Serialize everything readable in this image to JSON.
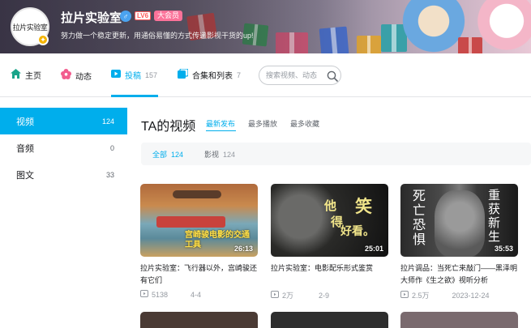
{
  "header": {
    "avatar_text": "拉片实验室",
    "username": "拉片实验室",
    "level": "LV6",
    "vip": "大会员",
    "signature": "努力做一个稳定更新，用通俗易懂的方式传递影视干货的up!",
    "colors": {
      "accent": "#00aeec",
      "vip": "#fb7299",
      "level": "#ff5a5a"
    }
  },
  "nav": {
    "tabs": [
      {
        "label": "主页",
        "icon": "home-icon",
        "count": ""
      },
      {
        "label": "动态",
        "icon": "flower-icon",
        "count": ""
      },
      {
        "label": "投稿",
        "icon": "upload-icon",
        "count": "157",
        "active": true
      },
      {
        "label": "合集和列表",
        "icon": "collection-icon",
        "count": "7"
      }
    ],
    "search_placeholder": "搜索视频、动态"
  },
  "sidebar": {
    "items": [
      {
        "label": "视频",
        "count": "124",
        "active": true
      },
      {
        "label": "音频",
        "count": "0"
      },
      {
        "label": "图文",
        "count": "33"
      }
    ]
  },
  "main": {
    "title": "TA的视频",
    "sort_tabs": [
      "最新发布",
      "最多播放",
      "最多收藏"
    ],
    "filters": [
      {
        "label": "全部",
        "count": "124",
        "active": true
      },
      {
        "label": "影视",
        "count": "124"
      }
    ],
    "videos": [
      {
        "title": "拉片实验室：飞行器以外，宫崎骏还有它们",
        "duration": "26:13",
        "plays": "5138",
        "date": "4-4",
        "thumb_text": "宫崎骏电影的交通工具"
      },
      {
        "title": "拉片实验室：电影配乐形式鉴赏",
        "duration": "25:01",
        "plays": "2万",
        "date": "2-9",
        "thumb_text": [
          "他",
          "得",
          "笑",
          "好看。"
        ]
      },
      {
        "title": "拉片调品：当死亡来敲门——黑泽明大师作《生之欲》视听分析",
        "duration": "35:53",
        "plays": "2.5万",
        "date": "2023-12-24",
        "thumb_text": [
          "死",
          "亡",
          "恐",
          "惧",
          "重",
          "获",
          "新",
          "生"
        ]
      }
    ]
  }
}
